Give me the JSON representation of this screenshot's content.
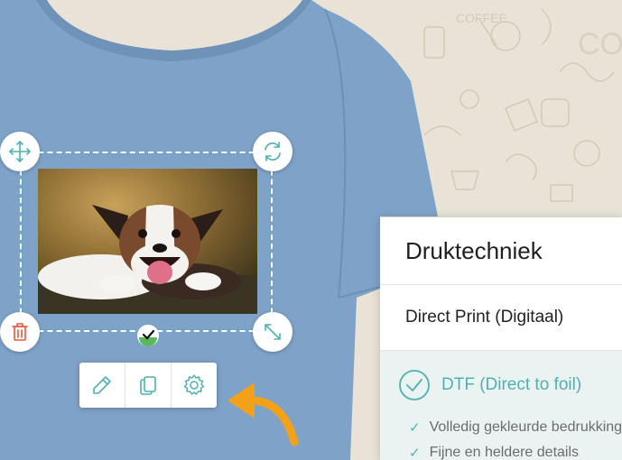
{
  "colors": {
    "accent": "#4fb1ae",
    "shirt": "#7fa2c8",
    "delete": "#e0593e",
    "arrow": "#f4a11a",
    "background": "#e8e3d6"
  },
  "handles": {
    "move_icon": "move-arrows-icon",
    "rotate_icon": "rotate-icon",
    "delete_icon": "trash-icon",
    "resize_icon": "resize-diagonal-icon"
  },
  "toolbar": {
    "edit_icon": "pencil-icon",
    "duplicate_icon": "copy-icon",
    "settings_icon": "gear-icon"
  },
  "panel": {
    "title": "Druktechniek",
    "options": [
      {
        "label": "Direct Print (Digitaal)",
        "selected": false
      },
      {
        "label": "DTF (Direct to foil)",
        "selected": true
      }
    ],
    "dtf_features": [
      "Volledig gekleurde bedrukking",
      "Fijne en heldere details"
    ]
  }
}
